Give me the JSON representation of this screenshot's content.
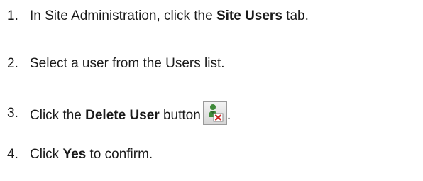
{
  "steps": [
    {
      "number": "1.",
      "before": "In Site Administration, click the ",
      "bold": "Site Users",
      "after": " tab."
    },
    {
      "number": "2.",
      "text": "Select a user from the Users list."
    },
    {
      "number": "3.",
      "before": "Click the ",
      "bold": "Delete User",
      "after": " button",
      "icon": "delete-user-icon",
      "trail": "."
    },
    {
      "number": "4.",
      "before": "Click ",
      "bold": "Yes",
      "after": " to confirm."
    }
  ],
  "colors": {
    "text": "#1a1a1a",
    "icon_figure": "#3f8a3a",
    "icon_badge": "#cc2a2a"
  }
}
